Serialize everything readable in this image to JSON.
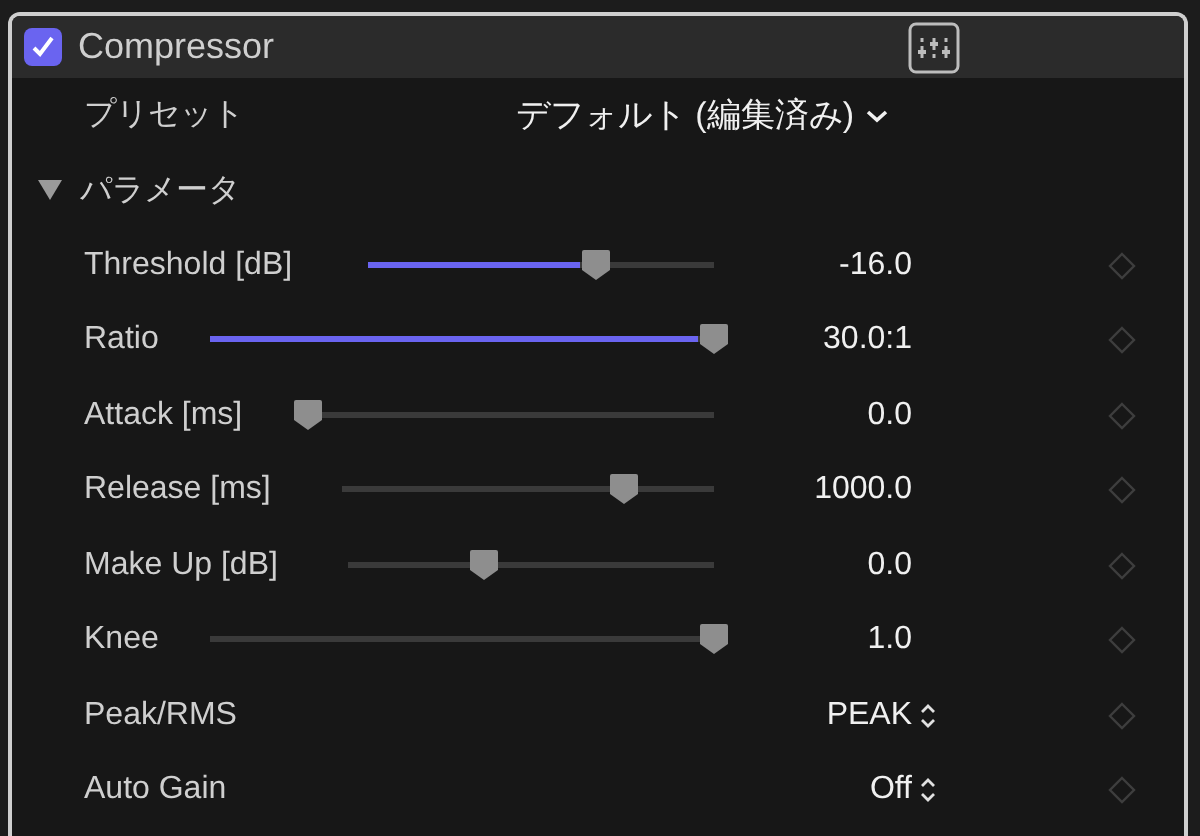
{
  "header": {
    "title": "Compressor",
    "enabled": true
  },
  "preset": {
    "label": "プリセット",
    "value": "デフォルト (編集済み)"
  },
  "section": {
    "title": "パラメータ",
    "expanded": true
  },
  "params": [
    {
      "kind": "slider",
      "label": "Threshold [dB]",
      "level": 0.66,
      "modified": true,
      "value": "-16.0"
    },
    {
      "kind": "slider",
      "label": "Ratio",
      "level": 1.0,
      "modified": true,
      "value": "30.0:1"
    },
    {
      "kind": "slider",
      "label": "Attack [ms]",
      "level": 0.0,
      "modified": false,
      "value": "0.0"
    },
    {
      "kind": "slider",
      "label": "Release [ms]",
      "level": 0.76,
      "modified": false,
      "value": "1000.0"
    },
    {
      "kind": "slider",
      "label": "Make Up [dB]",
      "level": 0.37,
      "modified": false,
      "value": "0.0"
    },
    {
      "kind": "slider",
      "label": "Knee",
      "level": 1.0,
      "modified": false,
      "value": "1.0"
    },
    {
      "kind": "popup",
      "label": "Peak/RMS",
      "value": "PEAK"
    },
    {
      "kind": "popup",
      "label": "Auto Gain",
      "value": "Off"
    }
  ]
}
